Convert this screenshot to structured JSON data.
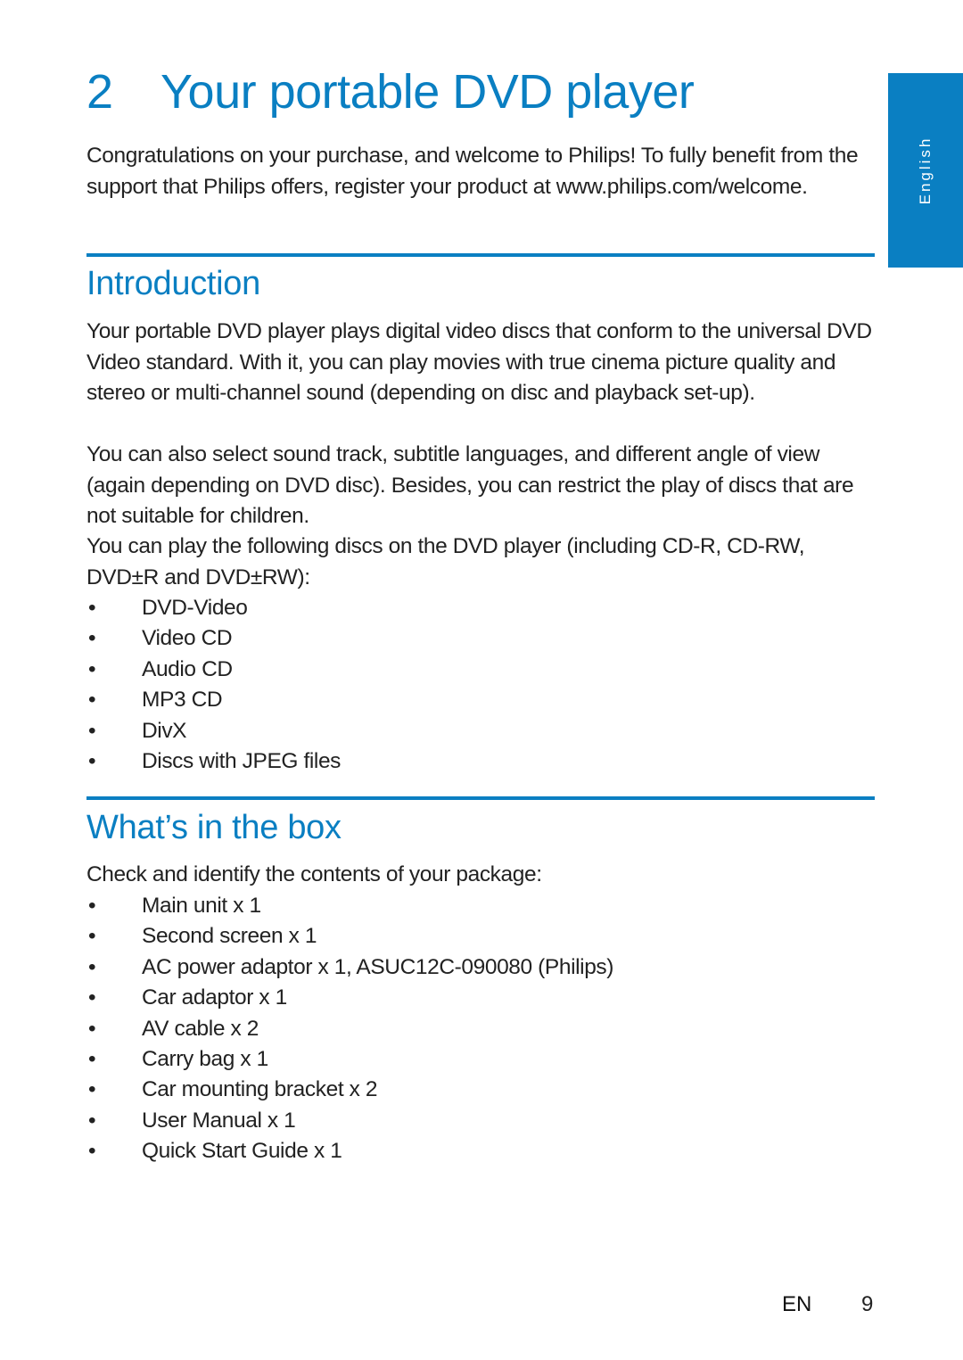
{
  "chapter": {
    "number": "2",
    "title": "Your portable DVD player"
  },
  "language_tab": "English",
  "intro_paragraph": "Congratulations on your purchase, and welcome to Philips! To fully benefit from the support that Philips offers, register your product at www.philips.com/welcome.",
  "sections": {
    "introduction": {
      "heading": "Introduction",
      "paragraphs": [
        "Your portable DVD player plays digital video discs that conform to the universal DVD Video standard. With it, you can play movies with true cinema picture quality and stereo or multi-channel sound (depending on disc and playback set-up).",
        "You can also select sound track, subtitle languages, and different angle of view (again depending on DVD disc). Besides, you can restrict the play of discs that are not suitable for children.",
        "You can play the following discs on the DVD player (including CD-R, CD-RW, DVD±R and DVD±RW):"
      ],
      "bullet_symbol": "•",
      "disc_types": [
        "DVD-Video",
        "Video CD",
        "Audio CD",
        "MP3 CD",
        "DivX",
        "Discs with JPEG files"
      ]
    },
    "whats_in_the_box": {
      "heading": "What’s in the box",
      "lead": "Check and identify the contents of your package:",
      "bullet_symbol": "•",
      "items": [
        "Main unit x 1",
        "Second screen x 1",
        "AC power adaptor x 1, ASUC12C-090080 (Philips)",
        "Car adaptor x 1",
        "AV cable x 2",
        "Carry bag x 1",
        "Car mounting bracket x 2",
        "User Manual x 1",
        "Quick Start Guide x 1"
      ]
    }
  },
  "footer": {
    "language_code": "EN",
    "page_number": "9"
  },
  "colors": {
    "accent": "#0a7fc2",
    "text": "#222222",
    "background": "#ffffff"
  }
}
